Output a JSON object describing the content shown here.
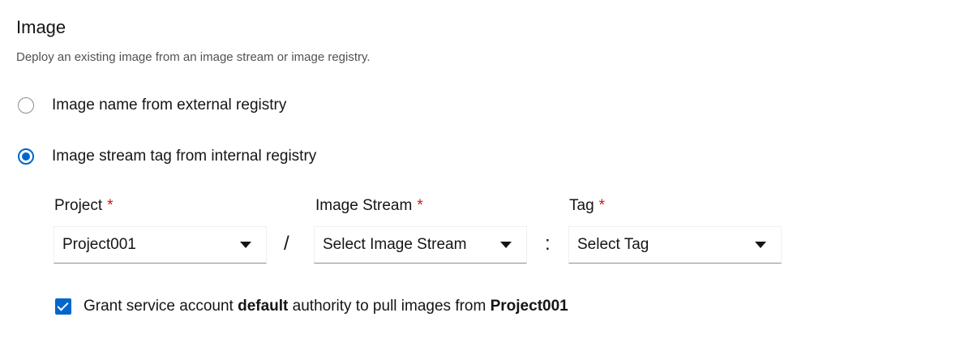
{
  "section": {
    "title": "Image",
    "description": "Deploy an existing image from an image stream or image registry."
  },
  "options": [
    {
      "label": "Image name from external registry",
      "selected": false
    },
    {
      "label": "Image stream tag from internal registry",
      "selected": true
    }
  ],
  "fields": {
    "project": {
      "label": "Project",
      "required_marker": "*",
      "value": "Project001"
    },
    "image_stream": {
      "label": "Image Stream",
      "required_marker": "*",
      "value": "Select Image Stream"
    },
    "tag": {
      "label": "Tag",
      "required_marker": "*",
      "value": "Select Tag"
    },
    "separator_slash": "/",
    "separator_colon": ":"
  },
  "grant": {
    "checked": true,
    "prefix": "Grant service account",
    "account": "default",
    "middle": "authority to pull images from",
    "project": "Project001"
  },
  "colors": {
    "accent": "#0066cc",
    "required": "#c9190b"
  }
}
